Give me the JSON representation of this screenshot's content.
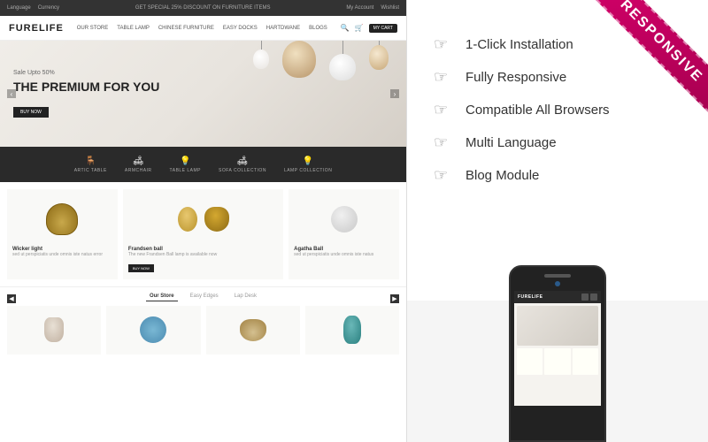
{
  "site": {
    "logo": "FURELIFE",
    "topbar": {
      "left_items": [
        "Language",
        "Currency"
      ],
      "center_text": "GET SPECIAL 25% DISCOUNT ON FURNITURE ITEMS",
      "right_items": [
        "My Account",
        "Wishlist"
      ]
    },
    "nav_links": [
      "OUR STORE",
      "TABLE LAMP",
      "CHINESE FURNITURE",
      "EASY DOCKS",
      "HARTDWANE",
      "BLOGS"
    ],
    "cart_label": "MY CART"
  },
  "hero": {
    "sale_text": "Sale Upto 50%",
    "title_line1": "THE PREMIUM FOR YOU",
    "btn_label": "BUY NOW"
  },
  "categories": [
    {
      "label": "ARTIC TABLE",
      "icon": "🪑"
    },
    {
      "label": "ARMCHAIR",
      "icon": "🛋"
    },
    {
      "label": "TABLE LAMP",
      "icon": "💡"
    },
    {
      "label": "SOFA COLLECTION",
      "icon": "🛋"
    },
    {
      "label": "LAMP COLLECTION",
      "icon": "💡"
    }
  ],
  "products": [
    {
      "name": "Wicker light",
      "desc": "sed ut perspiciatis unde omnis iste natus error",
      "has_btn": false
    },
    {
      "name": "Frandsen ball",
      "desc": "The new Frandsen Ball lamp is available now",
      "has_btn": true
    },
    {
      "name": "Agatha Ball",
      "desc": "sed ut perspiciatis unde omnis iste natus",
      "has_btn": false
    }
  ],
  "store_section": {
    "title": "Our Store",
    "tabs": [
      "Our Store",
      "Easy Edges",
      "Lap Desk"
    ]
  },
  "features": {
    "items": [
      {
        "icon": "☞",
        "text": "1-Click Installation"
      },
      {
        "icon": "☞",
        "text": "Fully Responsive"
      },
      {
        "icon": "☞",
        "text": "Compatible All Browsers"
      },
      {
        "icon": "☞",
        "text": "Multi Language"
      },
      {
        "icon": "☞",
        "text": "Blog Module"
      }
    ]
  },
  "ribbon": {
    "text": "RESPONSIVE"
  },
  "phone": {
    "logo": "FURELIFE"
  }
}
